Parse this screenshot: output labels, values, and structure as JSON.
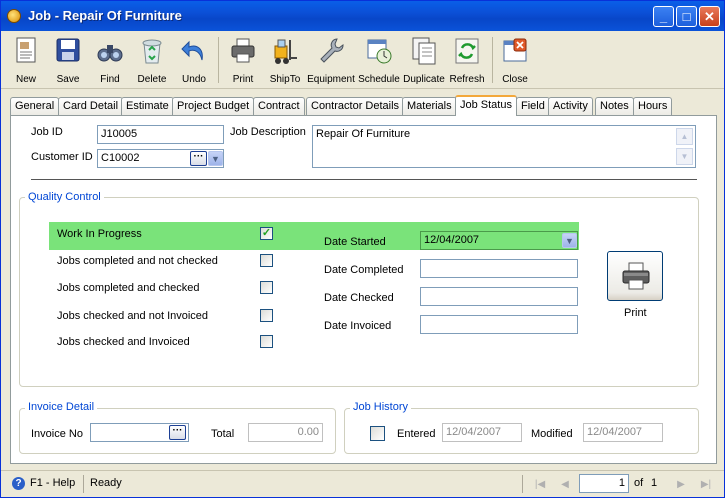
{
  "window": {
    "title": "Job - Repair Of Furniture",
    "controls": [
      "_",
      "□",
      "✕"
    ]
  },
  "toolbar": {
    "items": [
      {
        "label": "New",
        "icon": "new-document-icon"
      },
      {
        "label": "Save",
        "icon": "save-disk-icon"
      },
      {
        "label": "Find",
        "icon": "binoculars-icon"
      },
      {
        "label": "Delete",
        "icon": "recycle-bin-icon"
      },
      {
        "label": "Undo",
        "icon": "undo-arrow-icon"
      },
      {
        "label": "Print",
        "icon": "printer-icon"
      },
      {
        "label": "ShipTo",
        "icon": "forklift-icon"
      },
      {
        "label": "Equipment",
        "icon": "wrench-icon"
      },
      {
        "label": "Schedule",
        "icon": "calendar-clock-icon"
      },
      {
        "label": "Duplicate",
        "icon": "duplicate-pages-icon"
      },
      {
        "label": "Refresh",
        "icon": "refresh-icon"
      },
      {
        "label": "Close",
        "icon": "close-window-icon"
      }
    ]
  },
  "tabs": [
    "General",
    "Card Detail",
    "Estimate",
    "Project Budget",
    "Contract",
    "Contractor Details",
    "Materials",
    "Job Status",
    "Field",
    "Activity",
    "Notes",
    "Hours"
  ],
  "active_tab": "Job Status",
  "header": {
    "job_id_label": "Job ID",
    "job_id_value": "J10005",
    "customer_id_label": "Customer ID",
    "customer_id_value": "C10002",
    "job_description_label": "Job Description",
    "job_description_value": "Repair Of Furniture",
    "ellipsis": "···",
    "dropdown_glyph": "▼"
  },
  "quality_control": {
    "title": "Quality Control",
    "statuses": [
      {
        "label": "Work In Progress",
        "checked": true
      },
      {
        "label": "Jobs completed and not checked",
        "checked": false
      },
      {
        "label": "Jobs completed and checked",
        "checked": false
      },
      {
        "label": "Jobs checked and not Invoiced",
        "checked": false
      },
      {
        "label": "Jobs checked and Invoiced",
        "checked": false
      }
    ],
    "dates": [
      {
        "label": "Date Started",
        "value": "12/04/2007"
      },
      {
        "label": "Date Completed",
        "value": ""
      },
      {
        "label": "Date Checked",
        "value": ""
      },
      {
        "label": "Date Invoiced",
        "value": ""
      }
    ],
    "print_label": "Print",
    "check_glyph": "✓"
  },
  "invoice_detail": {
    "title": "Invoice Detail",
    "invoice_no_label": "Invoice No",
    "invoice_no_value": "",
    "total_label": "Total",
    "total_value": "0.00"
  },
  "job_history": {
    "title": "Job History",
    "entered_label": "Entered",
    "entered_value": "12/04/2007",
    "modified_label": "Modified",
    "modified_value": "12/04/2007"
  },
  "statusbar": {
    "help": "F1 - Help",
    "help_glyph": "?",
    "status": "Ready",
    "page": "1",
    "of_label": "of",
    "total_pages": "1",
    "nav": [
      "|◀",
      "◀",
      "▶",
      "▶|"
    ]
  },
  "colors": {
    "highlight": "#7ae37a",
    "titlebar": "#0a53d9",
    "group_title": "#0046d5"
  }
}
